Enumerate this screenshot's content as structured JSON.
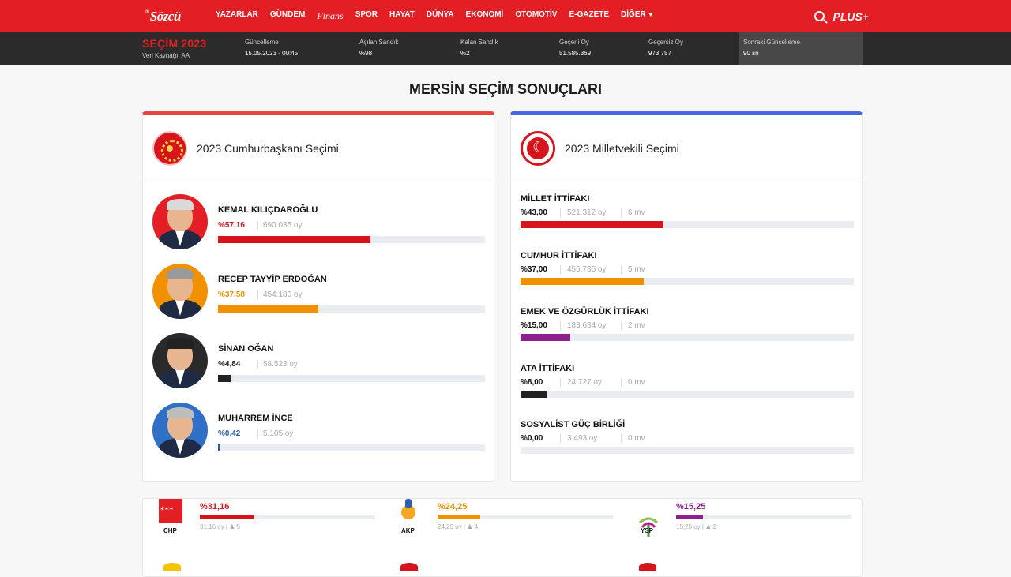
{
  "nav": {
    "logo": "Sözcü",
    "logo_prefix": "®",
    "items": [
      "YAZARLAR",
      "GÜNDEM",
      "Finans",
      "SPOR",
      "HAYAT",
      "DÜNYA",
      "EKONOMİ",
      "OTOMOTİV",
      "E-GAZETE",
      "DİĞER"
    ],
    "plus": "PLUS+"
  },
  "election_bar": {
    "title": "SEÇİM 2023",
    "source": "Veri Kaynağı: AA",
    "stats": [
      {
        "label": "Güncelleme",
        "value": "15.05.2023 - 00:45"
      },
      {
        "label": "Açılan Sandık",
        "value": "%98"
      },
      {
        "label": "Kalan Sandık",
        "value": "%2"
      },
      {
        "label": "Geçerli Oy",
        "value": "51.585.369"
      },
      {
        "label": "Geçersiz Oy",
        "value": "973.757"
      },
      {
        "label": "Sonraki Güncelleme",
        "value": "90 sn"
      }
    ]
  },
  "page_title": "MERSİN SEÇİM SONUÇLARI",
  "presidential": {
    "title": "2023 Cumhurbaşkanı Seçimi",
    "candidates": [
      {
        "name": "KEMAL KILIÇDAROĞLU",
        "pct_label": "%57,16",
        "votes": "690.035 oy",
        "percent": 57.16,
        "color": "#d7141c",
        "ring": "#e31e24",
        "hair": "#d9d9d9"
      },
      {
        "name": "RECEP TAYYİP ERDOĞAN",
        "pct_label": "%37,58",
        "votes": "454.180 oy",
        "percent": 37.58,
        "color": "#f29100",
        "ring": "#f29100",
        "hair": "#9a9a9a"
      },
      {
        "name": "SİNAN OĞAN",
        "pct_label": "%4,84",
        "votes": "58.523 oy",
        "percent": 4.84,
        "color": "#222222",
        "ring": "#2a2a2a",
        "hair": "#222"
      },
      {
        "name": "MUHARREM İNCE",
        "pct_label": "%0,42",
        "votes": "5.105 oy",
        "percent": 0.42,
        "color": "#2d5aa0",
        "ring": "#2f6fc6",
        "hair": "#bdbdbd"
      }
    ]
  },
  "parliament": {
    "title": "2023 Milletvekili Seçimi",
    "alliances": [
      {
        "name": "MİLLET İTTİFAKI",
        "pct_label": "%43,00",
        "votes": "521.312 oy",
        "seats": "6 mv",
        "percent": 43.0,
        "color": "#d7141c"
      },
      {
        "name": "CUMHUR İTTİFAKI",
        "pct_label": "%37,00",
        "votes": "455.735 oy",
        "seats": "5 mv",
        "percent": 37.0,
        "color": "#f29100"
      },
      {
        "name": "EMEK VE ÖZGÜRLÜK İTTİFAKI",
        "pct_label": "%15,00",
        "votes": "183.634 oy",
        "seats": "2 mv",
        "percent": 15.0,
        "color": "#8e1f8e"
      },
      {
        "name": "ATA İTTİFAKI",
        "pct_label": "%8,00",
        "votes": "24.727 oy",
        "seats": "0 mv",
        "percent": 8.0,
        "color": "#222222"
      },
      {
        "name": "SOSYALİST GÜÇ BİRLİĞİ",
        "pct_label": "%0,00",
        "votes": "3.493 oy",
        "seats": "0 mv",
        "percent": 0.0,
        "color": "#999999"
      }
    ]
  },
  "parties": [
    {
      "tag": "CHP",
      "pct_label": "%31,16",
      "percent": 31.16,
      "meta": "31,16 oy | ♟ 5",
      "color": "#d7141c"
    },
    {
      "tag": "AKP",
      "pct_label": "%24,25",
      "percent": 24.25,
      "meta": "24,25 oy | ♟ 4",
      "color": "#f29100"
    },
    {
      "tag": "YSP",
      "pct_label": "%15,25",
      "percent": 15.25,
      "meta": "15,25 oy | ♟ 2",
      "color": "#8e1f8e"
    }
  ]
}
